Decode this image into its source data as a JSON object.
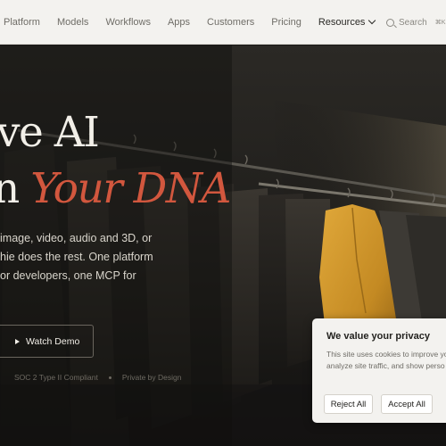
{
  "nav": {
    "items": [
      {
        "label": "Platform"
      },
      {
        "label": "Models"
      },
      {
        "label": "Workflows"
      },
      {
        "label": "Apps"
      },
      {
        "label": "Customers"
      },
      {
        "label": "Pricing"
      },
      {
        "label": "Resources"
      }
    ],
    "search_label": "Search",
    "search_shortcut": "⌘K"
  },
  "hero": {
    "headline_line1": "ve AI",
    "headline_line2_prefix": "n ",
    "headline_line2_accent": "Your DNA",
    "subtext": [
      " image, video, audio and 3D, or",
      "hie does the rest. One platform",
      "or developers, one MCP for"
    ],
    "watch_demo_label": "Watch Demo",
    "badges": [
      "SOC 2 Type II Compliant",
      "Private by Design"
    ]
  },
  "cookie": {
    "title": "We value your privacy",
    "body": [
      "This site uses cookies to improve yo",
      "analyze site traffic, and show perso"
    ],
    "reject_label": "Reject All",
    "accept_label": "Accept All"
  },
  "colors": {
    "accent": "#d2573e",
    "nav_bg": "#f3f2ef",
    "hero_bg": "#1a1917"
  }
}
